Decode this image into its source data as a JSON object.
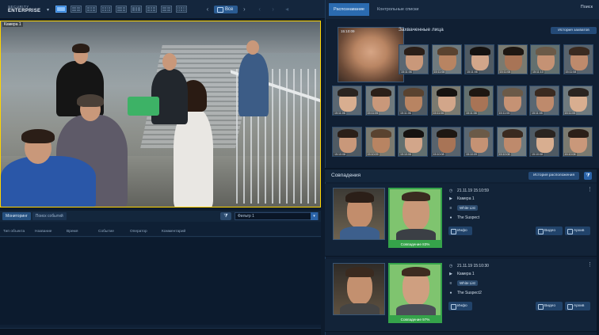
{
  "topbar": {
    "logo_line1": "SECURITY",
    "logo_line2": "ENTERPRISE",
    "all_button": "Все",
    "nav_prev": "‹",
    "nav_next": "›"
  },
  "camera": {
    "label": "Камера 1"
  },
  "events": {
    "tabs": [
      "Мониторинг",
      "Поиск событий"
    ],
    "filter_value": "Фильтр 1",
    "columns": [
      "Тип объекта",
      "Название",
      "Время",
      "Событие",
      "Оператор",
      "Комментарий"
    ]
  },
  "right": {
    "tabs": [
      "Распознавание",
      "Контрольные списки"
    ],
    "search_label": "Поиск",
    "captured_title": "Захваченные лица",
    "history_button": "История захватов",
    "big_face_time": "15:10:09",
    "faces": [
      {
        "time": "15:11:06"
      },
      {
        "time": "15:11:08"
      },
      {
        "time": "15:11:06"
      },
      {
        "time": "15:11:08"
      },
      {
        "time": "15:11:10"
      },
      {
        "time": "15:11:08"
      },
      {
        "time": "15:11:06"
      },
      {
        "time": "15:11:05"
      },
      {
        "time": "15:11:06"
      },
      {
        "time": "15:11:06"
      },
      {
        "time": "15:11:08"
      },
      {
        "time": "15:11:05"
      },
      {
        "time": "15:11:05"
      },
      {
        "time": "15:11:05"
      },
      {
        "time": "15:10:08"
      },
      {
        "time": "15:10:09"
      },
      {
        "time": "15:10:08"
      },
      {
        "time": "15:10:08"
      },
      {
        "time": "15:10:09"
      },
      {
        "time": "15:10:08"
      },
      {
        "time": "15:10:08"
      },
      {
        "time": "15:10:08"
      }
    ],
    "matches_title": "Совпадения",
    "location_history_button": "История расположения",
    "matches": [
      {
        "datetime": "21.11.19 15:10:59",
        "camera": "Камера 1",
        "list": "White List",
        "person": "The Suspect",
        "score": "Совпадение 83%",
        "info_button": "Инфо",
        "video_button": "Видео",
        "archive_button": "Архив"
      },
      {
        "datetime": "21.11.19 15:10:30",
        "camera": "Камера 1",
        "list": "White List",
        "person": "The Suspect2",
        "score": "Совпадение 97%",
        "info_button": "Инфо",
        "video_button": "Видео",
        "archive_button": "Архив"
      }
    ]
  }
}
